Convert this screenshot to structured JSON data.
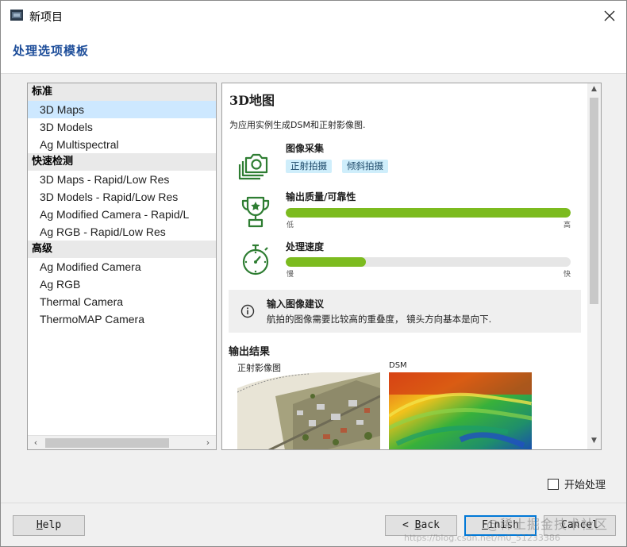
{
  "window": {
    "title": "新项目",
    "app_icon": "pix4d-app-icon",
    "close_icon": "close-icon"
  },
  "header": {
    "heading": "处理选项模板"
  },
  "template_list": {
    "groups": [
      {
        "label": "标准",
        "items": [
          "3D Maps",
          "3D Models",
          "Ag Multispectral"
        ]
      },
      {
        "label": "快速检测",
        "items": [
          "3D Maps - Rapid/Low Res",
          "3D Models - Rapid/Low Res",
          "Ag Modified Camera - Rapid/L",
          "Ag RGB - Rapid/Low Res"
        ]
      },
      {
        "label": "高级",
        "items": [
          "Ag Modified Camera",
          "Ag RGB",
          "Thermal Camera",
          "ThermoMAP Camera"
        ]
      }
    ],
    "selected": "3D Maps",
    "scroll_left": "‹",
    "scroll_right": "›"
  },
  "detail": {
    "title": "3D地图",
    "description": "为应用实例生成DSM和正射影像图.",
    "capture": {
      "label": "图像采集",
      "icon": "camera-stack-icon",
      "tags": [
        "正射拍摄",
        "倾斜拍摄"
      ]
    },
    "quality": {
      "label": "输出质量/可靠性",
      "icon": "trophy-icon",
      "value": 1.0,
      "min_label": "低",
      "max_label": "高"
    },
    "speed": {
      "label": "处理速度",
      "icon": "stopwatch-icon",
      "value": 0.28,
      "min_label": "慢",
      "max_label": "快"
    },
    "tip": {
      "icon": "info-icon",
      "title": "输入图像建议",
      "text": "航拍的图像需要比较高的重叠度， 镜头方向基本是向下."
    },
    "output": {
      "heading": "输出结果",
      "ortho_label": "正射影像图",
      "dsm_label": "DSM"
    },
    "scroll_up": "▲",
    "scroll_down": "▼"
  },
  "options": {
    "start_processing_label": "开始处理",
    "start_processing_checked": false
  },
  "buttons": {
    "help_key": "H",
    "help_rest": "elp",
    "back_prefix": "< ",
    "back_key": "B",
    "back_rest": "ack",
    "finish_key": "F",
    "finish_rest": "inish",
    "cancel_label": "Cancel"
  },
  "watermark": {
    "text": "@稀土掘金技术社区",
    "url": "https://blog.csdn.net/m0_51233386"
  },
  "colors": {
    "accent": "#1e4e9a",
    "bar_fill": "#7cbb1f",
    "selection": "#cde8ff",
    "tag_bg": "#cfeefb",
    "icon_green": "#2e7d32"
  }
}
